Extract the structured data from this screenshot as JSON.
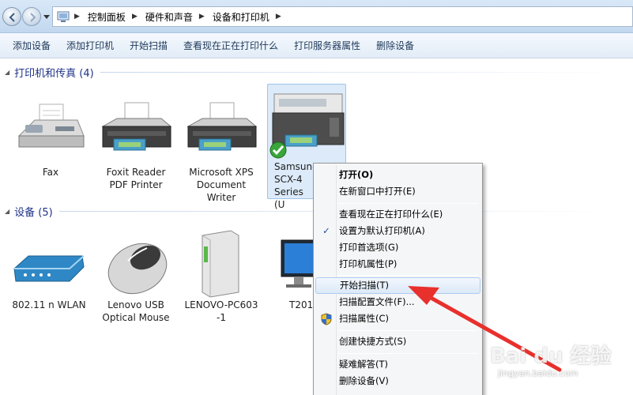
{
  "breadcrumbs": [
    "控制面板",
    "硬件和声音",
    "设备和打印机"
  ],
  "toolbar": [
    "添加设备",
    "添加打印机",
    "开始扫描",
    "查看现在正在打印什么",
    "打印服务器属性",
    "删除设备"
  ],
  "groups": {
    "printers": {
      "title": "打印机和传真 (4)"
    },
    "devices": {
      "title": "设备 (5)"
    }
  },
  "printers": [
    {
      "label": "Fax",
      "icon": "fax-icon"
    },
    {
      "label": "Foxit Reader PDF Printer",
      "icon": "printer-icon"
    },
    {
      "label": "Microsoft XPS Document Writer",
      "icon": "printer-icon"
    },
    {
      "label": "Samsung SCX-4 Series (U",
      "icon": "multifunction-printer-icon",
      "selected": true,
      "default": true
    }
  ],
  "devices": [
    {
      "label": "802.11 n WLAN",
      "icon": "router-icon"
    },
    {
      "label": "Lenovo USB Optical Mouse",
      "icon": "mouse-icon"
    },
    {
      "label": "LENOVO-PC603 -1",
      "icon": "pc-tower-icon"
    },
    {
      "label": "T2014",
      "icon": "monitor-icon"
    }
  ],
  "context_menu": {
    "items": [
      {
        "label": "打开(O)",
        "bold": true
      },
      {
        "label": "在新窗口中打开(E)"
      },
      {
        "label": "查看现在正在打印什么(E)"
      },
      {
        "label": "设置为默认打印机(A)",
        "checked": true
      },
      {
        "label": "打印首选项(G)"
      },
      {
        "label": "打印机属性(P)"
      },
      {
        "label": "开始扫描(T)",
        "highlighted": true
      },
      {
        "label": "扫描配置文件(F)..."
      },
      {
        "label": "扫描属性(C)",
        "icon": "uac-shield-icon"
      },
      {
        "label": "创建快捷方式(S)"
      },
      {
        "label": "疑难解答(T)"
      },
      {
        "label": "删除设备(V)"
      }
    ]
  },
  "watermark": {
    "brand": "Bai du 经验",
    "sub": "jingyan.baidu.com"
  },
  "colors": {
    "arrow": "#e8302c",
    "selection": "#dceaf9",
    "group_title": "#1e3287"
  }
}
